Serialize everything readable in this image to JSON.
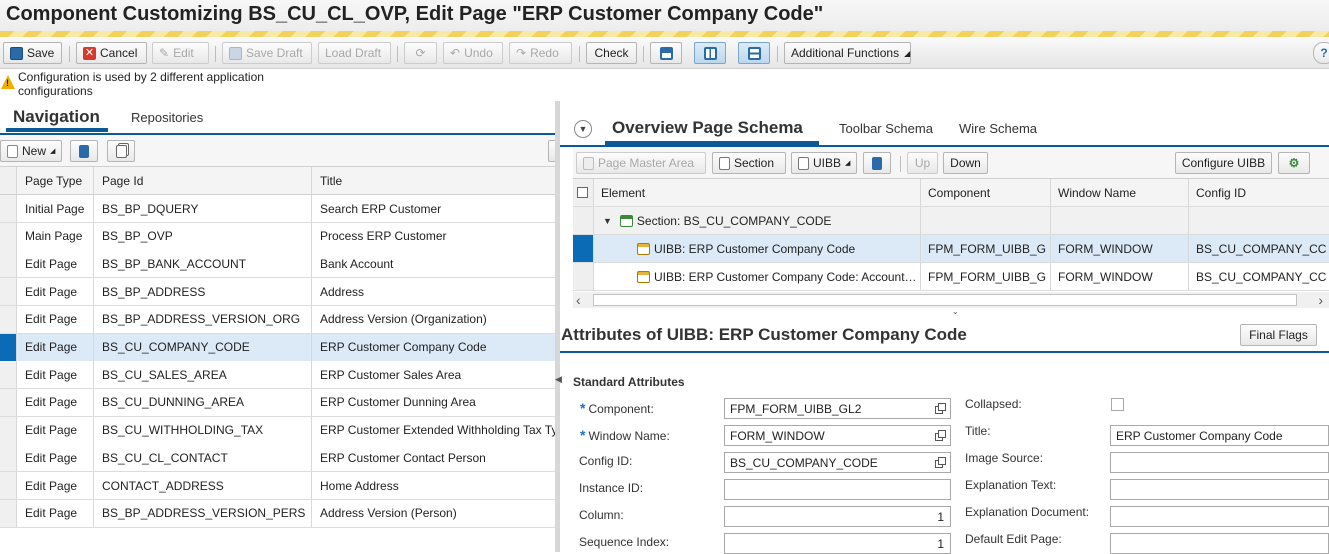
{
  "title": "Component Customizing BS_CU_CL_OVP, Edit Page \"ERP Customer Company Code\"",
  "toolbar": {
    "save": "Save",
    "cancel": "Cancel",
    "edit": "Edit",
    "save_draft": "Save Draft",
    "load_draft": "Load Draft",
    "undo": "Undo",
    "redo": "Redo",
    "check": "Check",
    "additional": "Additional Functions"
  },
  "message": {
    "icon": "warning-icon",
    "text": "Configuration is used by 2 different application configurations"
  },
  "navigation": {
    "tabs": [
      "Navigation",
      "Repositories"
    ],
    "new_label": "New",
    "columns": [
      "Page Type",
      "Page Id",
      "Title"
    ],
    "rows": [
      {
        "type": "Initial Page",
        "id": "BS_BP_DQUERY",
        "title": "Search ERP Customer"
      },
      {
        "type": "Main Page",
        "id": "BS_BP_OVP",
        "title": "Process ERP Customer"
      },
      {
        "type": "Edit Page",
        "id": "BS_BP_BANK_ACCOUNT",
        "title": "Bank Account"
      },
      {
        "type": "Edit Page",
        "id": "BS_BP_ADDRESS",
        "title": "Address"
      },
      {
        "type": "Edit Page",
        "id": "BS_BP_ADDRESS_VERSION_ORG",
        "title": "Address Version (Organization)"
      },
      {
        "type": "Edit Page",
        "id": "BS_CU_COMPANY_CODE",
        "title": "ERP Customer Company Code"
      },
      {
        "type": "Edit Page",
        "id": "BS_CU_SALES_AREA",
        "title": "ERP Customer Sales Area"
      },
      {
        "type": "Edit Page",
        "id": "BS_CU_DUNNING_AREA",
        "title": "ERP Customer Dunning Area"
      },
      {
        "type": "Edit Page",
        "id": "BS_CU_WITHHOLDING_TAX",
        "title": "ERP Customer Extended Withholding Tax Ty"
      },
      {
        "type": "Edit Page",
        "id": "BS_CU_CL_CONTACT",
        "title": "ERP Customer Contact Person"
      },
      {
        "type": "Edit Page",
        "id": "CONTACT_ADDRESS",
        "title": "Home Address"
      },
      {
        "type": "Edit Page",
        "id": "BS_BP_ADDRESS_VERSION_PERS",
        "title": "Address Version (Person)"
      }
    ]
  },
  "overview": {
    "tabs": [
      "Overview Page Schema",
      "Toolbar Schema",
      "Wire Schema"
    ],
    "toolbar": {
      "page_master": "Page Master Area",
      "section": "Section",
      "uibb": "UIBB",
      "up": "Up",
      "down": "Down",
      "configure": "Configure UIBB"
    },
    "columns": [
      "Element",
      "Component",
      "Window Name",
      "Config ID"
    ],
    "rows": [
      {
        "element": "Section: BS_CU_COMPANY_CODE",
        "component": "",
        "window": "",
        "config": ""
      },
      {
        "element": "UIBB: ERP Customer Company Code",
        "component": "FPM_FORM_UIBB_G",
        "window": "FORM_WINDOW",
        "config": "BS_CU_COMPANY_CC"
      },
      {
        "element": "UIBB: ERP Customer Company Code: Account…",
        "component": "FPM_FORM_UIBB_G",
        "window": "FORM_WINDOW",
        "config": "BS_CU_COMPANY_CC"
      }
    ]
  },
  "attributes": {
    "heading": "Attributes of UIBB: ERP Customer Company Code",
    "final_flags": "Final Flags",
    "section": "Standard Attributes",
    "required_mark": "*",
    "left": [
      {
        "label": "Component:",
        "value": "FPM_FORM_UIBB_GL2"
      },
      {
        "label": "Window Name:",
        "value": "FORM_WINDOW"
      },
      {
        "label": "Config ID:",
        "value": "BS_CU_COMPANY_CODE"
      },
      {
        "label": "Instance ID:",
        "value": ""
      },
      {
        "label": "Column:",
        "value": "1"
      },
      {
        "label": "Sequence Index:",
        "value": "1"
      }
    ],
    "right": [
      {
        "label": "Collapsed:",
        "value": ""
      },
      {
        "label": "Title:",
        "value": "ERP Customer Company Code"
      },
      {
        "label": "Image Source:",
        "value": ""
      },
      {
        "label": "Explanation Text:",
        "value": ""
      },
      {
        "label": "Explanation Document:",
        "value": ""
      },
      {
        "label": "Default Edit Page:",
        "value": ""
      }
    ]
  },
  "colors": {
    "accent": "#0a5a9a",
    "selection": "#dbeaf6",
    "marker": "#0b6bb6"
  }
}
